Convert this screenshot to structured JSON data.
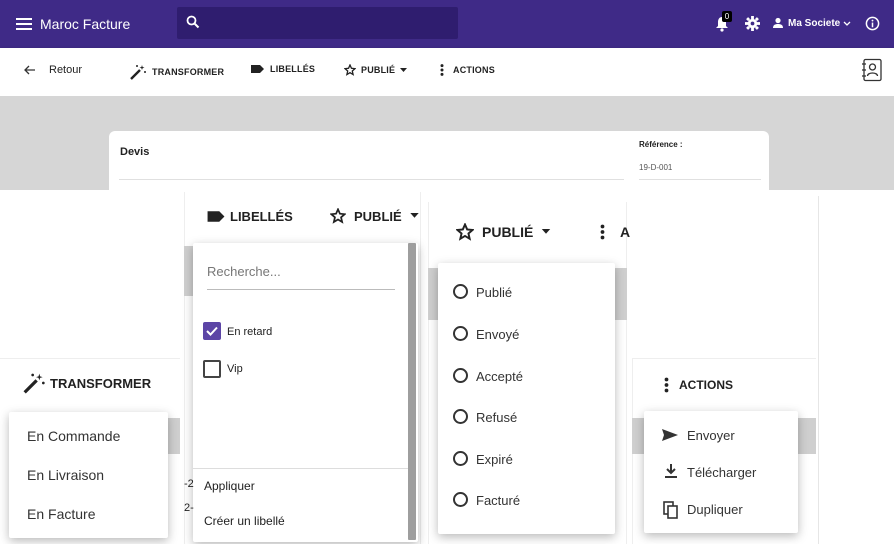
{
  "topbar": {
    "app_title": "Maroc Facture",
    "notification_count": "0",
    "company": "Ma Societe",
    "accent": "#3f2a87"
  },
  "toolbar": {
    "back": "Retour",
    "transform": "TRANSFORMER",
    "labels": "LIBELLÉS",
    "status": "PUBLIÉ",
    "actions": "ACTIONS"
  },
  "document": {
    "title": "Devis",
    "reference_label": "Référence :",
    "reference_value": "19-D-001"
  },
  "labels_panel": {
    "header_labels": "LIBELLÉS",
    "header_status": "PUBLIÉ",
    "search_placeholder": "Recherche...",
    "options": [
      {
        "label": "En retard",
        "checked": true
      },
      {
        "label": "Vip",
        "checked": false
      }
    ],
    "apply": "Appliquer",
    "create": "Créer un libellé"
  },
  "status_panel": {
    "header": "PUBLIÉ",
    "header_cut": "A",
    "options": [
      "Publié",
      "Envoyé",
      "Accepté",
      "Refusé",
      "Expiré",
      "Facturé"
    ]
  },
  "transform_panel": {
    "header": "TRANSFORMER",
    "options": [
      "En Commande",
      "En Livraison",
      "En Facture"
    ]
  },
  "actions_panel": {
    "header": "ACTIONS",
    "options": [
      "Envoyer",
      "Télécharger",
      "Dupliquer"
    ]
  },
  "background_fragments": [
    "-2",
    "2-"
  ]
}
